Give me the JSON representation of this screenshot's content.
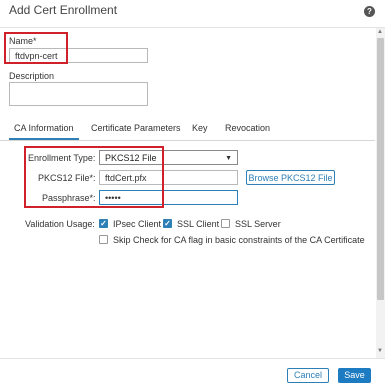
{
  "dialog": {
    "title": "Add Cert Enrollment",
    "help_icon": "?"
  },
  "form": {
    "name_label": "Name*",
    "name_value": "ftdvpn-cert",
    "description_label": "Description",
    "description_value": ""
  },
  "tabs": [
    {
      "label": "CA Information",
      "active": true
    },
    {
      "label": "Certificate Parameters",
      "active": false
    },
    {
      "label": "Key",
      "active": false
    },
    {
      "label": "Revocation",
      "active": false
    }
  ],
  "ca_info": {
    "enrollment_type_label": "Enrollment Type:",
    "enrollment_type_value": "PKCS12 File",
    "pkcs12_file_label": "PKCS12 File*:",
    "pkcs12_file_value": "ftdCert.pfx",
    "browse_button": "Browse PKCS12 File",
    "passphrase_label": "Passphrase*:",
    "passphrase_value": "•••••",
    "validation_usage_label": "Validation Usage:",
    "usage_options": [
      {
        "label": "IPsec Client",
        "checked": true
      },
      {
        "label": "SSL Client",
        "checked": true
      },
      {
        "label": "SSL Server",
        "checked": false
      }
    ],
    "skip_check_label": "Skip Check for CA flag in basic constraints of the CA Certificate",
    "skip_check_checked": false
  },
  "footer": {
    "cancel_label": "Cancel",
    "save_label": "Save"
  },
  "colors": {
    "accent": "#1d7bc1",
    "highlight": "#d0202a"
  }
}
